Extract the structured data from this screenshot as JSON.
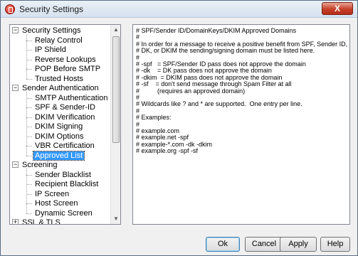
{
  "window": {
    "title": "Security Settings"
  },
  "tree": {
    "items": [
      {
        "label": "Security Settings",
        "level": 0,
        "expanded": true
      },
      {
        "label": "Relay Control",
        "level": 1
      },
      {
        "label": "IP Shield",
        "level": 1
      },
      {
        "label": "Reverse Lookups",
        "level": 1
      },
      {
        "label": "POP Before SMTP",
        "level": 1
      },
      {
        "label": "Trusted Hosts",
        "level": 1
      },
      {
        "label": "Sender Authentication",
        "level": 0,
        "expanded": true
      },
      {
        "label": "SMTP Authentication",
        "level": 1
      },
      {
        "label": "SPF & Sender-ID",
        "level": 1
      },
      {
        "label": "DKIM Verification",
        "level": 1
      },
      {
        "label": "DKIM Signing",
        "level": 1
      },
      {
        "label": "DKIM Options",
        "level": 1
      },
      {
        "label": "VBR Certification",
        "level": 1
      },
      {
        "label": "Approved List",
        "level": 1,
        "selected": true
      },
      {
        "label": "Screening",
        "level": 0,
        "expanded": true
      },
      {
        "label": "Sender Blacklist",
        "level": 1
      },
      {
        "label": "Recipient Blacklist",
        "level": 1
      },
      {
        "label": "IP Screen",
        "level": 1
      },
      {
        "label": "Host Screen",
        "level": 1
      },
      {
        "label": "Dynamic Screen",
        "level": 1
      },
      {
        "label": "SSL & TLS",
        "level": 0,
        "expanded": false
      }
    ]
  },
  "editor": {
    "lines": [
      "# SPF/Sender ID/DomainKeys/DKIM Approved Domains",
      "#",
      "# In order for a message to receive a positive benefit from SPF, Sender ID,",
      "# DK, or DKIM the sending/signing domain must be listed here.",
      "#",
      "# -spf   = SPF/Sender ID pass does not approve the domain",
      "# -dk    = DK pass does not approve the domain",
      "# -dkim  = DKIM pass does not approve the domain",
      "# -sf    = don't send message through Spam Filter at all",
      "#          (requires an approved domain)",
      "#",
      "# Wildcards like ? and * are supported.  One entry per line.",
      "#",
      "# Examples:",
      "#",
      "# example.com",
      "# example.net -spf",
      "# example-*.com -dk -dkim",
      "# example.org -spf -sf"
    ]
  },
  "buttons": {
    "ok": "Ok",
    "cancel": "Cancel",
    "apply": "Apply",
    "help": "Help"
  },
  "close_label": "X",
  "colors": {
    "selection": "#3399ff",
    "close": "#c7402a"
  }
}
